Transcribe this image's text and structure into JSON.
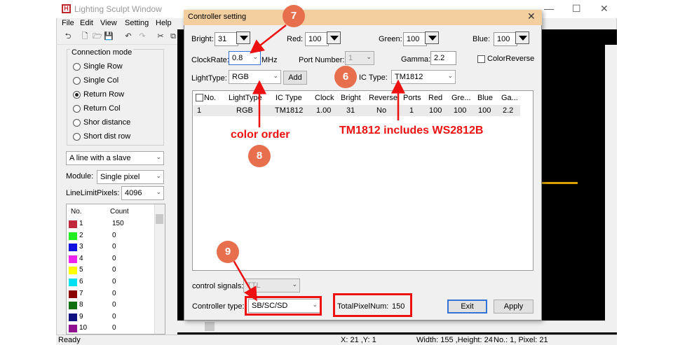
{
  "app": {
    "title": "Lighting Sculpt Window",
    "logo": "H",
    "window_controls": [
      "—",
      "☐",
      "✕"
    ]
  },
  "menu": [
    "File",
    "Edit",
    "View",
    "Setting",
    "Help"
  ],
  "toolbar": [
    "undo-icon",
    "new-icon",
    "open-icon",
    "save-icon",
    "undo-arrow-icon",
    "redo-arrow-icon",
    "cut-icon",
    "copy-icon"
  ],
  "sidebar": {
    "connection_title": "Connection mode",
    "modes": [
      {
        "label": "Single Row",
        "selected": false
      },
      {
        "label": "Single Col",
        "selected": false
      },
      {
        "label": "Return Row",
        "selected": true
      },
      {
        "label": "Return Col",
        "selected": false
      },
      {
        "label": "Shor distance",
        "selected": false
      },
      {
        "label": "Short dist row",
        "selected": false
      }
    ],
    "slave_mode": "A line with a slave",
    "module_label": "Module:",
    "module_value": "Single pixel",
    "line_limit_label": "LineLimitPixels:",
    "line_limit_value": "4096",
    "list_headers": {
      "no": "No.",
      "count": "Count"
    },
    "list": [
      {
        "no": "1",
        "count": "150",
        "color": "#c0283c"
      },
      {
        "no": "2",
        "count": "0",
        "color": "#22ee22"
      },
      {
        "no": "3",
        "count": "0",
        "color": "#1010e0"
      },
      {
        "no": "4",
        "count": "0",
        "color": "#ee22ee"
      },
      {
        "no": "5",
        "count": "0",
        "color": "#ffff00"
      },
      {
        "no": "6",
        "count": "0",
        "color": "#00e0f0"
      },
      {
        "no": "7",
        "count": "0",
        "color": "#8b0000"
      },
      {
        "no": "8",
        "count": "0",
        "color": "#107010"
      },
      {
        "no": "9",
        "count": "0",
        "color": "#101080"
      },
      {
        "no": "10",
        "count": "0",
        "color": "#901090"
      }
    ]
  },
  "status": {
    "ready": "Ready",
    "xy": "X: 21 ,Y: 1",
    "size": "Width: 155 ,Height: 24",
    "info": "No.: 1, Pixel: 21"
  },
  "dialog": {
    "title": "Controller setting",
    "close": "✕",
    "bright_label": "Bright:",
    "bright": "31",
    "red_label": "Red:",
    "red": "100",
    "green_label": "Green:",
    "green": "100",
    "blue_label": "Blue:",
    "blue": "100",
    "clock_label": "ClockRate:",
    "clock": "0.8",
    "clock_unit": "MHz",
    "port_label": "Port Number:",
    "port": "1",
    "gamma_label": "Gamma:",
    "gamma": "2.2",
    "color_reverse": "ColorReverse",
    "lighttype_label": "LightType:",
    "lighttype": "RGB",
    "add_button": "Add",
    "ictype_label": "IC Type:",
    "ictype": "TM1812",
    "table_headers": [
      "No.",
      "LightType",
      "IC Type",
      "Clock",
      "Bright",
      "Reverse",
      "Ports",
      "Red",
      "Gre...",
      "Blue",
      "Ga..."
    ],
    "table_row": [
      "1",
      "RGB",
      "TM1812",
      "1.00",
      "31",
      "No",
      "1",
      "100",
      "100",
      "100",
      "2.2"
    ],
    "control_signals_label": "control signals:",
    "control_signals": "TTL",
    "controller_type_label": "Controller type:",
    "controller_type": "SB/SC/SD",
    "total_label": "TotalPixelNum:",
    "total": "150",
    "exit": "Exit",
    "apply": "Apply"
  },
  "annotations": {
    "n6": "6",
    "n7": "7",
    "n8": "8",
    "n9": "9",
    "color_order": "color order",
    "tm_note": "TM1812 includes WS2812B"
  },
  "colors": {
    "accent": "#e11111",
    "badge": "#e86f4e",
    "dialog_title": "#f3cf9f"
  }
}
